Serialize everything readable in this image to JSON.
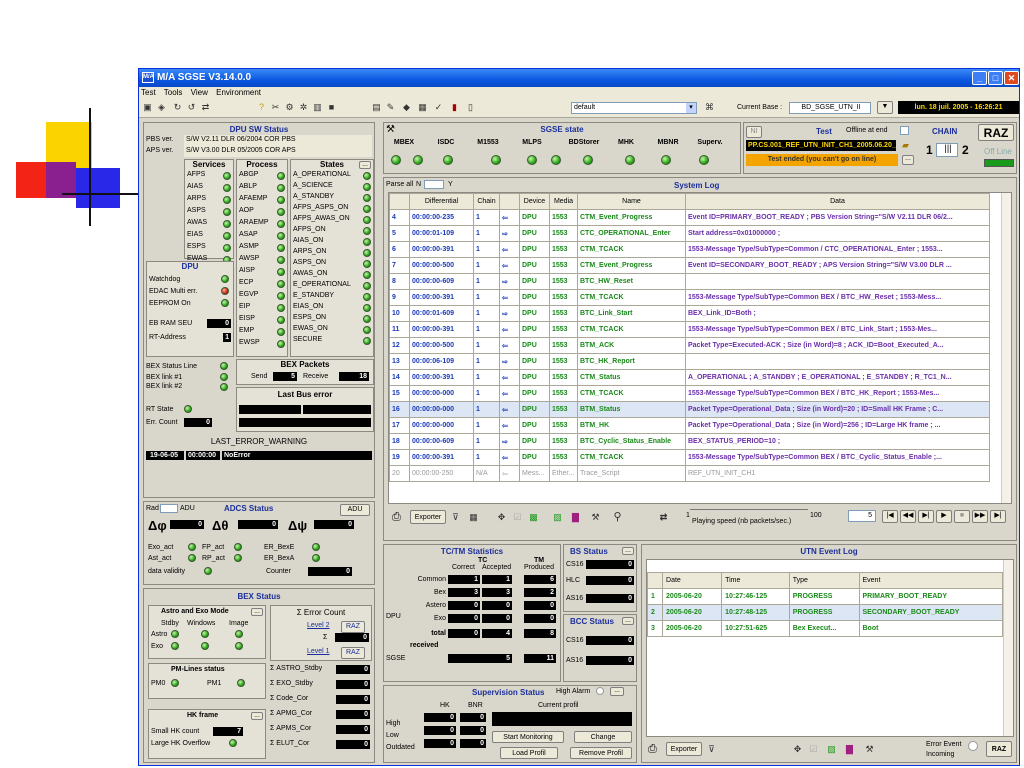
{
  "window": {
    "title": "M/A SGSE  V3.14.0.0",
    "menu": [
      "Test",
      "Tools",
      "View",
      "Environment"
    ]
  },
  "toolbar": {
    "profile": "default",
    "current_base_label": "Current Base :",
    "current_base": "BD_SGSE_UTN_II",
    "datetime": "lun. 18 juil. 2005 - 16:26:21"
  },
  "dpu_sw": {
    "title": "DPU SW Status",
    "pbs_label": "PBS ver.",
    "pbs": "S/W V2.11 DLR 06/2004 COR PBS",
    "aps_label": "APS ver.",
    "aps": "S/W V3.00 DLR 05/2005 COR APS",
    "services_title": "Services",
    "services": [
      "AFPS",
      "AIAS",
      "ARPS",
      "ASPS",
      "AWAS",
      "EIAS",
      "ESPS",
      "EWAS"
    ],
    "process_title": "Process",
    "process": [
      "ABGP",
      "ABLP",
      "AFAEMP",
      "AOP",
      "ARAEMP",
      "ASAP",
      "ASMP",
      "AWSP",
      "AISP",
      "ECP",
      "EGVP",
      "EIP",
      "EISP",
      "EMP",
      "EWSP"
    ],
    "states_title": "States",
    "states": [
      "A_OPERATIONAL",
      "A_SCIENCE",
      "A_STANDBY",
      "AFPS_ASPS_ON",
      "AFPS_AWAS_ON",
      "AFPS_ON",
      "AIAS_ON",
      "ARPS_ON",
      "ASPS_ON",
      "AWAS_ON",
      "E_OPERATIONAL",
      "E_STANDBY",
      "EIAS_ON",
      "ESPS_ON",
      "EWAS_ON",
      "SECURE"
    ]
  },
  "dpu": {
    "title": "DPU",
    "watchdog": "Watchdog",
    "edac": "EDAC Multi err.",
    "eeprom": "EEPROM On",
    "ebram": "EB RAM SEU",
    "ebram_val": "0",
    "rtaddr": "RT-Address",
    "rtaddr_val": "1"
  },
  "bex": {
    "status_line": "BEX Status Line",
    "link1": "BEX link #1",
    "link2": "BEX link #2",
    "packets_title": "BEX Packets",
    "send": "Send",
    "send_val": "5",
    "receive": "Receive",
    "receive_val": "18",
    "last_bus_error": "Last Bus error",
    "rt_state": "RT State",
    "err_count": "Err. Count",
    "err_val": "0"
  },
  "last_error": {
    "title": "LAST_ERROR_WARNING",
    "date": "19-06-05",
    "time": "00:00:00",
    "text": "NoError"
  },
  "adcs": {
    "rad": "Rad",
    "adu": "ADU",
    "title": "ADCS Status",
    "adu_btn": "ADU",
    "dphi": "Δφ",
    "dphi_val": "0",
    "dtheta": "Δθ",
    "dtheta_val": "0",
    "dpsi": "Δψ",
    "dpsi_val": "0",
    "exo_act": "Exo_act",
    "fp_act": "FP_act",
    "er_bexe": "ER_BexE",
    "ast_act": "Ast_act",
    "rp_act": "RP_act",
    "er_bexa": "ER_BexA",
    "validity": "data validity",
    "counter": "Counter",
    "counter_val": "0"
  },
  "bex_status": {
    "title": "BEX Status",
    "astro_exo": "Astro and Exo Mode",
    "cols": [
      "Stdby",
      "Windows",
      "Image"
    ],
    "astro": "Astro",
    "exo": "Exo",
    "pm_title": "PM-Lines status",
    "pm0": "PM0",
    "pm1": "PM1",
    "hk_title": "HK frame",
    "small_hk": "Small HK count",
    "small_hk_val": "7",
    "large_hk": "Large HK Overflow",
    "err_title": "Σ Error Count",
    "level2": "Level 2",
    "raz": "RAZ",
    "sigma": "Σ",
    "sigma_val": "0",
    "level1": "Level 1",
    "sums": [
      {
        "label": "Σ ASTRO_Stdby",
        "val": "0"
      },
      {
        "label": "Σ EXO_Stdby",
        "val": "0"
      },
      {
        "label": "Σ Code_Cor",
        "val": "0"
      },
      {
        "label": "Σ APMG_Cor",
        "val": "0"
      },
      {
        "label": "Σ APMS_Cor",
        "val": "0"
      },
      {
        "label": "Σ ELUT_Cor",
        "val": "0"
      }
    ]
  },
  "sgse": {
    "title": "SGSE state",
    "items": [
      "MBEX",
      "ISDC",
      "M1553",
      "MLPS",
      "BDStorer",
      "MHK",
      "MBNR",
      "Superv."
    ],
    "ni": "NI",
    "test": "Test",
    "offline": "Offline at end",
    "chain": "CHAIN",
    "raz": "RAZ",
    "test_name": "PP.CS.001_REF_UTN_INIT_CH1_2005.06.20_",
    "test_ended": "Test ended (you can't go on line)",
    "chain1": "1",
    "chain2": "2",
    "offline_btn": "Off Line"
  },
  "syslog": {
    "parse_all": "Parse all",
    "n": "N",
    "y": "Y",
    "title": "System Log",
    "headers": [
      "",
      "Differential",
      "Chain",
      "",
      "Device",
      "Media",
      "Name",
      "Data"
    ],
    "rows": [
      {
        "n": "4",
        "t": "00:00:00-235",
        "c": "1",
        "dir": "⇦",
        "dev": "DPU",
        "m": "1553",
        "name": "CTM_Event_Progress",
        "data": "Event ID=PRIMARY_BOOT_READY ; PBS Version String=\"S/W V2.11 DLR 06/2..."
      },
      {
        "n": "5",
        "t": "00:00:01-109",
        "c": "1",
        "dir": "⇨",
        "dev": "DPU",
        "m": "1553",
        "name": "CTC_OPERATIONAL_Enter",
        "data": "Start address=0x01000000 ;"
      },
      {
        "n": "6",
        "t": "00:00:00-391",
        "c": "1",
        "dir": "⇦",
        "dev": "DPU",
        "m": "1553",
        "name": "CTM_TCACK",
        "data": "1553-Message Type/SubType=Common / CTC_OPERATIONAL_Enter ; 1553..."
      },
      {
        "n": "7",
        "t": "00:00:00-500",
        "c": "1",
        "dir": "⇦",
        "dev": "DPU",
        "m": "1553",
        "name": "CTM_Event_Progress",
        "data": "Event ID=SECONDARY_BOOT_READY ; APS Version String=\"S/W V3.00 DLR ..."
      },
      {
        "n": "8",
        "t": "00:00:00-609",
        "c": "1",
        "dir": "⇨",
        "dev": "DPU",
        "m": "1553",
        "name": "BTC_HW_Reset",
        "data": ""
      },
      {
        "n": "9",
        "t": "00:00:00-391",
        "c": "1",
        "dir": "⇦",
        "dev": "DPU",
        "m": "1553",
        "name": "CTM_TCACK",
        "data": "1553-Message Type/SubType=Common BEX / BTC_HW_Reset ; 1553-Mess..."
      },
      {
        "n": "10",
        "t": "00:00:01-609",
        "c": "1",
        "dir": "⇨",
        "dev": "DPU",
        "m": "1553",
        "name": "BTC_Link_Start",
        "data": "BEX_Link_ID=Both ;"
      },
      {
        "n": "11",
        "t": "00:00:00-391",
        "c": "1",
        "dir": "⇦",
        "dev": "DPU",
        "m": "1553",
        "name": "CTM_TCACK",
        "data": "1553-Message Type/SubType=Common BEX / BTC_Link_Start ; 1553-Mes..."
      },
      {
        "n": "12",
        "t": "00:00:00-500",
        "c": "1",
        "dir": "⇦",
        "dev": "DPU",
        "m": "1553",
        "name": "BTM_ACK",
        "data": "Packet Type=Executed-ACK ; Size (in Word)=8 ;  ACK_ID=Boot_Executed_A..."
      },
      {
        "n": "13",
        "t": "00:00:06-109",
        "c": "1",
        "dir": "⇨",
        "dev": "DPU",
        "m": "1553",
        "name": "BTC_HK_Report",
        "data": ""
      },
      {
        "n": "14",
        "t": "00:00:00-391",
        "c": "1",
        "dir": "⇦",
        "dev": "DPU",
        "m": "1553",
        "name": "CTM_Status",
        "data": "A_OPERATIONAL ; A_STANDBY ; E_OPERATIONAL ; E_STANDBY ;   R_TC1_N..."
      },
      {
        "n": "15",
        "t": "00:00:00-000",
        "c": "1",
        "dir": "⇦",
        "dev": "DPU",
        "m": "1553",
        "name": "CTM_TCACK",
        "data": "1553-Message Type/SubType=Common BEX / BTC_HK_Report ; 1553-Mes..."
      },
      {
        "n": "16",
        "t": "00:00:00-000",
        "c": "1",
        "dir": "⇦",
        "dev": "DPU",
        "m": "1553",
        "name": "BTM_Status",
        "data": "Packet Type=Operational_Data ; Size (in Word)=20 ;  ID=Small HK Frame ; C..."
      },
      {
        "n": "17",
        "t": "00:00:00-000",
        "c": "1",
        "dir": "⇦",
        "dev": "DPU",
        "m": "1553",
        "name": "BTM_HK",
        "data": "Packet Type=Operational_Data ; Size (in Word)=256 ;  ID=Large HK frame ; ..."
      },
      {
        "n": "18",
        "t": "00:00:00-609",
        "c": "1",
        "dir": "⇨",
        "dev": "DPU",
        "m": "1553",
        "name": "BTC_Cyclic_Status_Enable",
        "data": "BEX_STATUS_PERIOD=10 ;"
      },
      {
        "n": "19",
        "t": "00:00:00-391",
        "c": "1",
        "dir": "⇦",
        "dev": "DPU",
        "m": "1553",
        "name": "CTM_TCACK",
        "data": "1553-Message Type/SubType=Common BEX / BTC_Cyclic_Status_Enable ;..."
      },
      {
        "n": "20",
        "t": "00:00:00-250",
        "c": "N/A",
        "dir": "⇦",
        "dev": "Mess...",
        "m": "Ether...",
        "name": "Trace_Script",
        "data": "REF_UTN_INIT_CH1"
      }
    ],
    "exporter": "Exporter",
    "speed_label": "Playing speed (nb packets/sec.)",
    "speed_min": "1",
    "speed_max": "100",
    "speed_val": "5"
  },
  "tctm": {
    "title": "TC/TM Statistics",
    "tc": "TC",
    "correct": "Correct",
    "accepted": "Accepted",
    "tm": "TM",
    "produced": "Produced",
    "dpu": "DPU",
    "sgse": "SGSE",
    "total": "total",
    "received": "received",
    "rows": [
      {
        "label": "Common",
        "c": "1",
        "a": "1",
        "p": "6"
      },
      {
        "label": "Bex",
        "c": "3",
        "a": "3",
        "p": "2"
      },
      {
        "label": "Astero",
        "c": "0",
        "a": "0",
        "p": "0"
      },
      {
        "label": "Exo",
        "c": "0",
        "a": "0",
        "p": "0"
      },
      {
        "label": "total",
        "c": "4",
        "a": "4",
        "p": "8"
      }
    ],
    "received_val": "0",
    "sgse_c": "5",
    "sgse_p": "11"
  },
  "bs": {
    "title": "BS Status",
    "cs16": "CS16",
    "cs16_val": "0",
    "hlc": "HLC",
    "hlc_val": "0",
    "as16": "AS16",
    "as16_val": "0"
  },
  "bcc": {
    "title": "BCC Status",
    "cs16": "CS16",
    "cs16_val": "0",
    "as16": "AS16",
    "as16_val": "0"
  },
  "superv": {
    "title": "Supervision Status",
    "high_alarm": "High Alarm",
    "hk": "HK",
    "bnr": "BNR",
    "current_profil": "Current profil",
    "high": "High",
    "low": "Low",
    "outdated": "Outdated",
    "vals": [
      "0",
      "0",
      "0",
      "0",
      "0",
      "0"
    ],
    "start": "Start Monitoring",
    "change": "Change",
    "load": "Load Profil",
    "remove": "Remove Profil"
  },
  "utn": {
    "title": "UTN Event Log",
    "headers": [
      "",
      "Date",
      "Time",
      "Type",
      "Event"
    ],
    "rows": [
      {
        "n": "1",
        "date": "2005-06-20",
        "time": "10:27:46-125",
        "type": "PROGRESS",
        "event": "PRIMARY_BOOT_READY"
      },
      {
        "n": "2",
        "date": "2005-06-20",
        "time": "10:27:48-125",
        "type": "PROGRESS",
        "event": "SECONDARY_BOOT_READY"
      },
      {
        "n": "3",
        "date": "2005-06-20",
        "time": "10:27:51-625",
        "type": "Bex Execut...",
        "event": "Boot"
      }
    ],
    "exporter": "Exporter",
    "error_event": "Error Event",
    "incoming": "Incoming",
    "raz": "RAZ"
  }
}
